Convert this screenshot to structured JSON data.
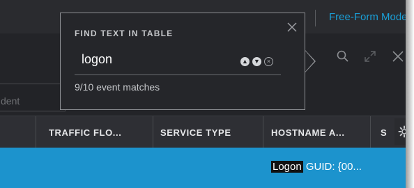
{
  "header": {
    "mode_link": "Free-Form Mode"
  },
  "toolbar": {
    "icons": [
      "search-icon",
      "expand-icon",
      "close-icon"
    ]
  },
  "filter": {
    "value_fragment": "dent"
  },
  "table": {
    "columns": [
      "TRAFFIC FLO...",
      "SERVICE TYPE",
      "HOSTNAME A...",
      "S"
    ],
    "row": {
      "match": "Logon",
      "rest": " GUID: {00..."
    }
  },
  "find_dialog": {
    "title": "FIND TEXT IN TABLE",
    "query": "logon",
    "status": "9/10 event matches"
  },
  "colors": {
    "accent": "#1aa0d8",
    "row_highlight": "#1c93cd",
    "dark_bg": "#232428"
  }
}
